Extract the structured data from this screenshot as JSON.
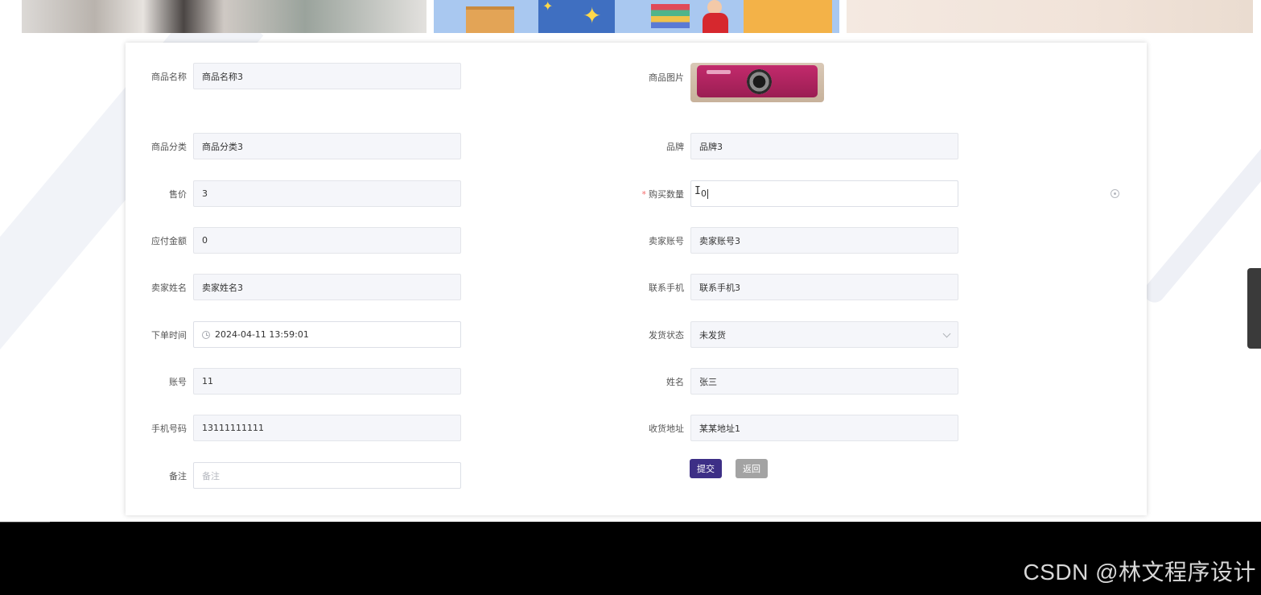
{
  "form": {
    "product_name": {
      "label": "商品名称",
      "value": "商品名称3"
    },
    "product_image": {
      "label": "商品图片"
    },
    "category": {
      "label": "商品分类",
      "value": "商品分类3"
    },
    "brand": {
      "label": "品牌",
      "value": "品牌3"
    },
    "price": {
      "label": "售价",
      "value": "3"
    },
    "quantity": {
      "label": "购买数量",
      "required_mark": "*",
      "value": "0"
    },
    "amount_due": {
      "label": "应付金额",
      "value": "0"
    },
    "seller_account": {
      "label": "卖家账号",
      "value": "卖家账号3"
    },
    "seller_name": {
      "label": "卖家姓名",
      "value": "卖家姓名3"
    },
    "contact_phone": {
      "label": "联系手机",
      "value": "联系手机3"
    },
    "order_time": {
      "label": "下单时间",
      "value": "2024-04-11 13:59:01"
    },
    "ship_status": {
      "label": "发货状态",
      "value": "未发货"
    },
    "account": {
      "label": "账号",
      "value": "11"
    },
    "name": {
      "label": "姓名",
      "value": "张三"
    },
    "phone": {
      "label": "手机号码",
      "value": "13111111111"
    },
    "address": {
      "label": "收货地址",
      "value": "某某地址1"
    },
    "remark": {
      "label": "备注",
      "placeholder": "备注"
    }
  },
  "buttons": {
    "submit": "提交",
    "back": "返回"
  },
  "watermark": "CSDN @林文程序设计",
  "colors": {
    "primary": "#3d2f86",
    "back_button": "#a3a3a3",
    "required": "#f56c6c"
  }
}
